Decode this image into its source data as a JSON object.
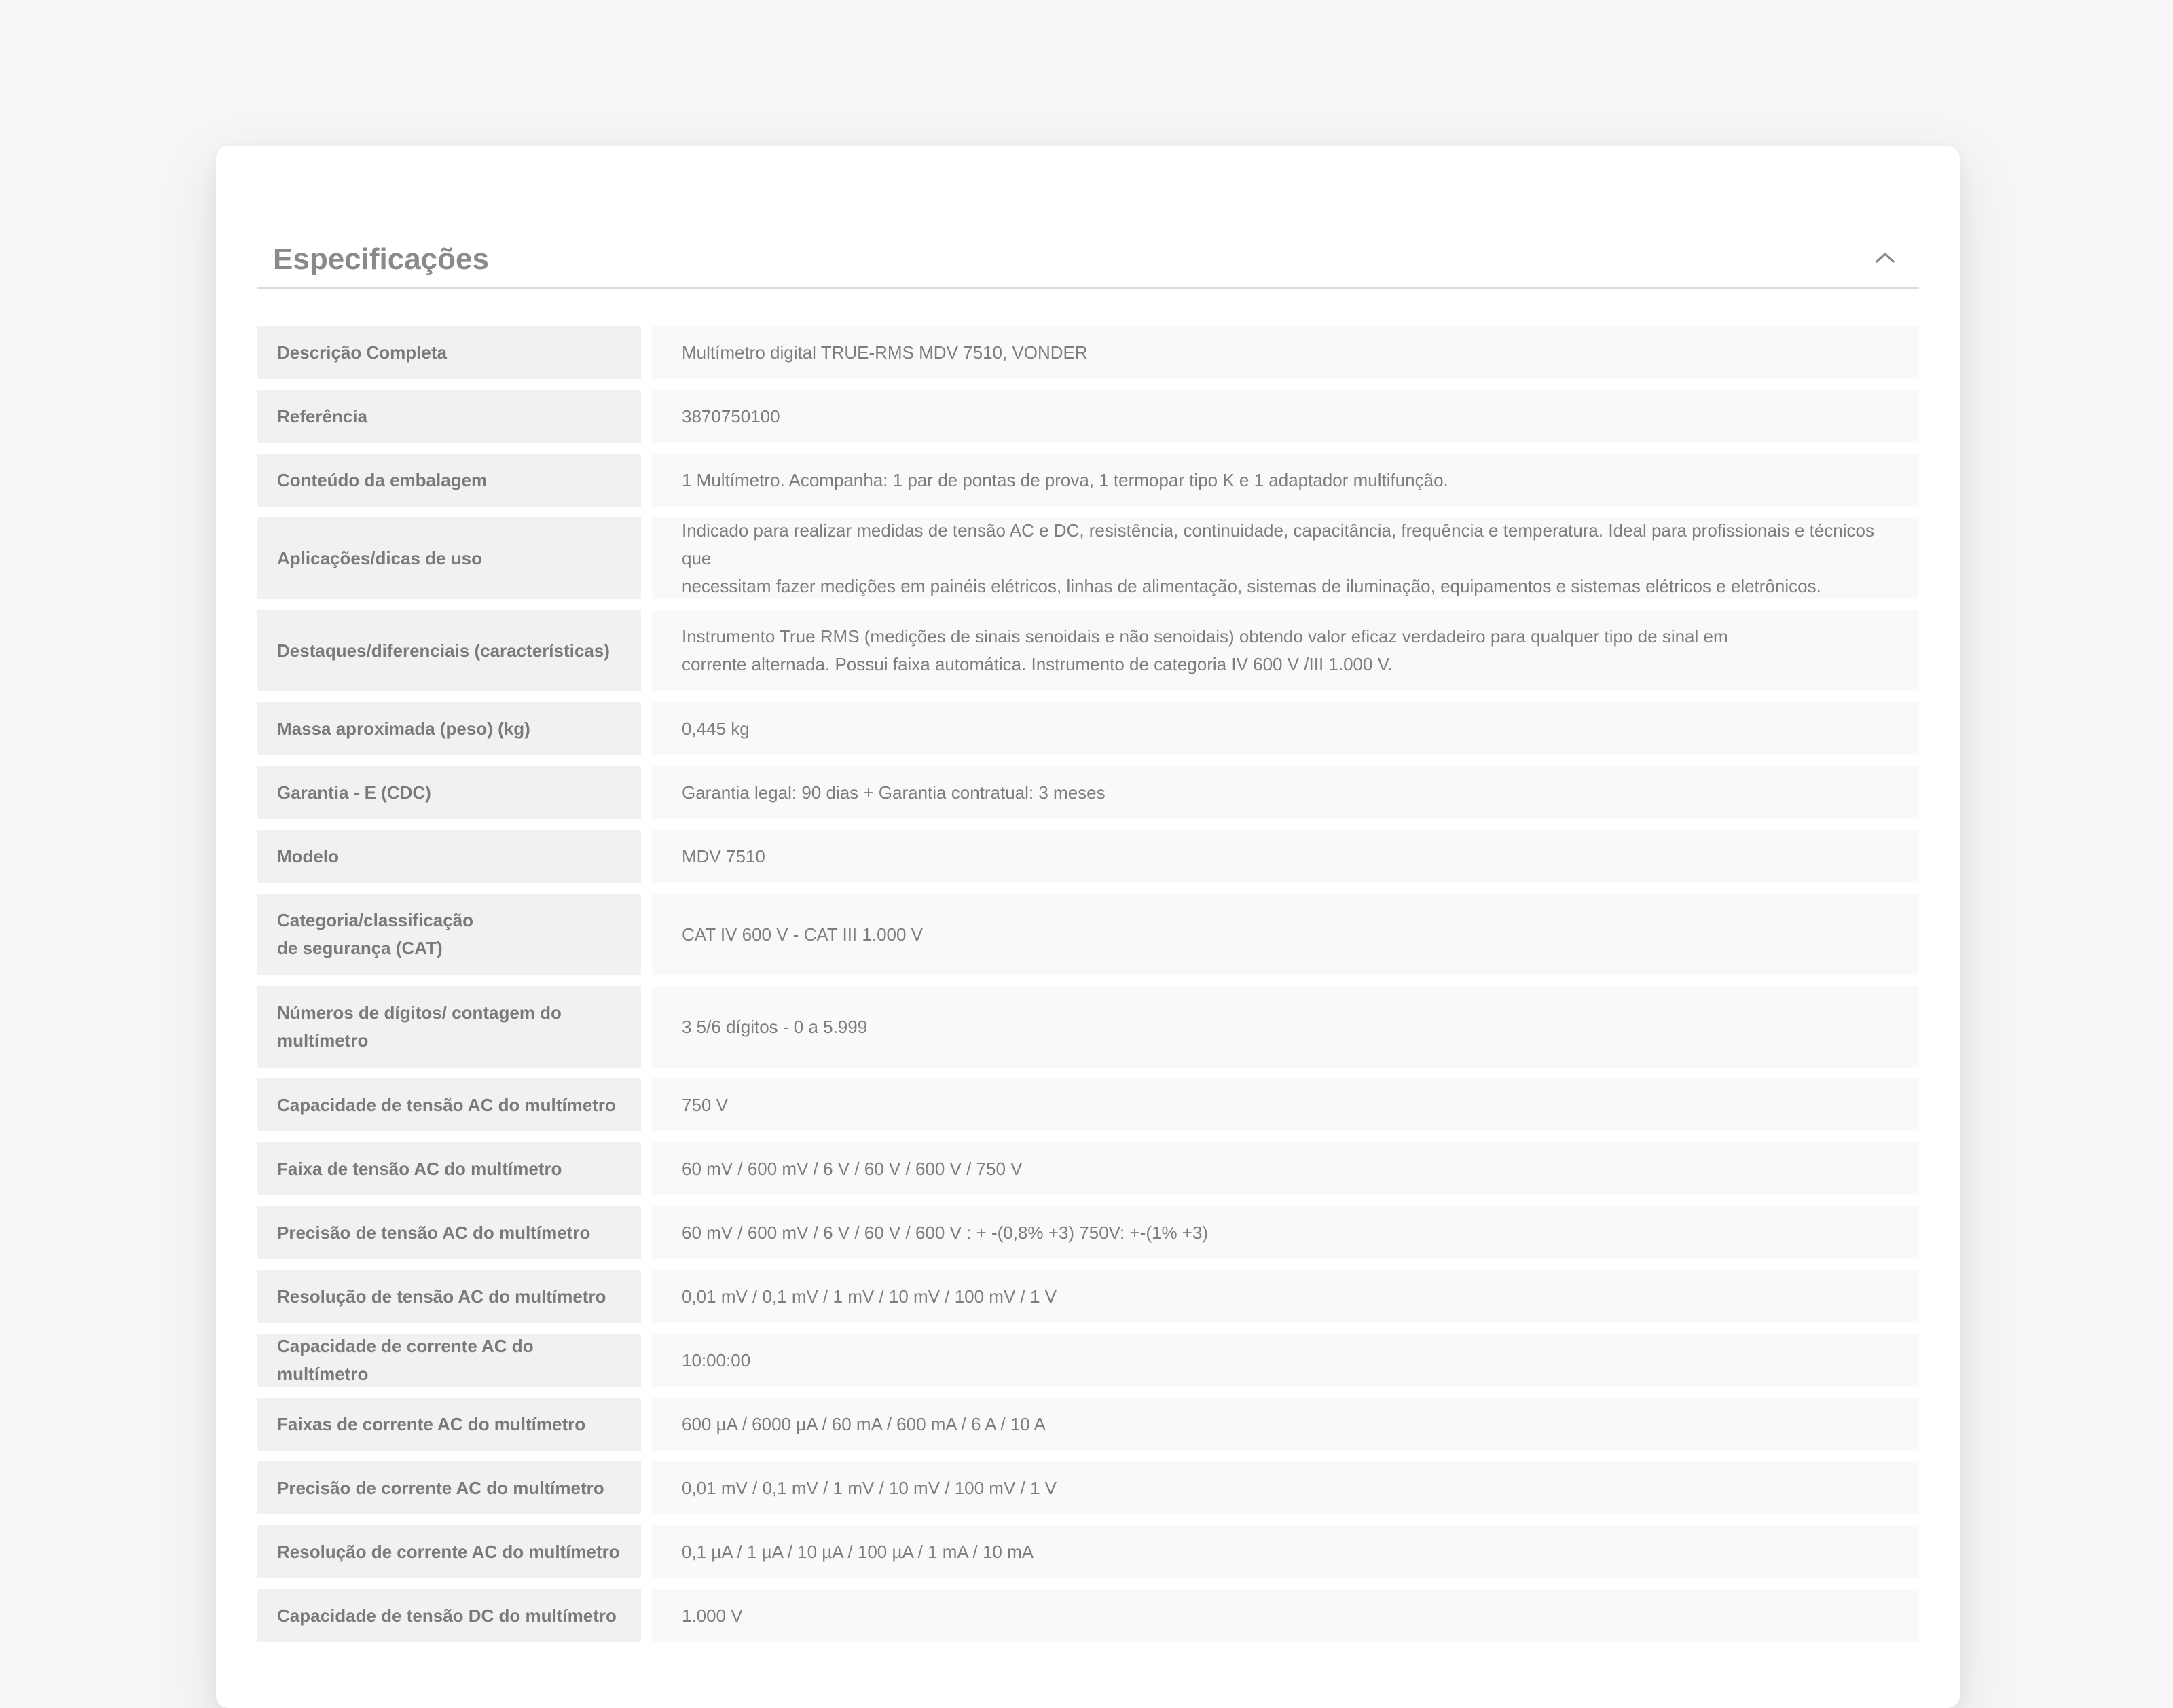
{
  "section": {
    "title": "Especificações",
    "collapse_icon": "chevron-up-icon"
  },
  "specs": [
    {
      "label": "Descrição Completa",
      "value": "Multímetro digital TRUE-RMS MDV 7510, VONDER"
    },
    {
      "label": "Referência",
      "value": "3870750100"
    },
    {
      "label": "Conteúdo da embalagem",
      "value": "1 Multímetro. Acompanha: 1 par de pontas de prova, 1 termopar tipo K e 1 adaptador multifunção."
    },
    {
      "label": "Aplicações/dicas de uso",
      "value": "Indicado para realizar medidas de tensão AC e DC, resistência, continuidade, capacitância, frequência e temperatura. Ideal para profissionais e técnicos que\nnecessitam fazer medições em painéis elétricos, linhas de alimentação, sistemas de iluminação, equipamentos e sistemas elétricos e eletrônicos."
    },
    {
      "label": "Destaques/diferenciais (características)",
      "value": "Instrumento True RMS (medições de sinais senoidais e não senoidais) obtendo valor eficaz verdadeiro para qualquer tipo de sinal em\ncorrente alternada. Possui faixa automática. Instrumento de categoria IV 600 V /III 1.000 V."
    },
    {
      "label": "Massa aproximada (peso) (kg)",
      "value": "0,445 kg"
    },
    {
      "label": "Garantia - E (CDC)",
      "value": "Garantia legal: 90 dias + Garantia contratual: 3 meses"
    },
    {
      "label": "Modelo",
      "value": "MDV 7510"
    },
    {
      "label": "Categoria/classificação\nde segurança (CAT)",
      "value": "CAT IV 600 V - CAT III 1.000 V"
    },
    {
      "label": "Números de dígitos/ contagem do\nmultímetro",
      "value": "3 5/6 dígitos - 0 a 5.999"
    },
    {
      "label": "Capacidade de tensão AC do multímetro",
      "value": "750 V"
    },
    {
      "label": "Faixa de tensão AC do multímetro",
      "value": "60 mV / 600 mV / 6 V / 60 V / 600 V / 750 V"
    },
    {
      "label": "Precisão de tensão AC do multímetro",
      "value": "60 mV / 600 mV / 6 V / 60 V / 600 V : + -(0,8% +3) 750V: +-(1% +3)"
    },
    {
      "label": "Resolução de tensão AC do multímetro",
      "value": "0,01 mV / 0,1 mV / 1 mV / 10 mV / 100 mV / 1 V"
    },
    {
      "label": "Capacidade de corrente AC do multímetro",
      "value": "10:00:00"
    },
    {
      "label": "Faixas de corrente AC do multímetro",
      "value": "600 µA / 6000 µA / 60 mA / 600 mA / 6 A / 10 A"
    },
    {
      "label": "Precisão de corrente AC do multímetro",
      "value": "0,01 mV / 0,1 mV / 1 mV / 10 mV / 100 mV / 1 V"
    },
    {
      "label": "Resolução de corrente AC do multímetro",
      "value": "0,1 µA / 1 µA / 10 µA / 100 µA / 1 mA / 10 mA"
    },
    {
      "label": "Capacidade de tensão DC do multímetro",
      "value": "1.000 V"
    }
  ]
}
